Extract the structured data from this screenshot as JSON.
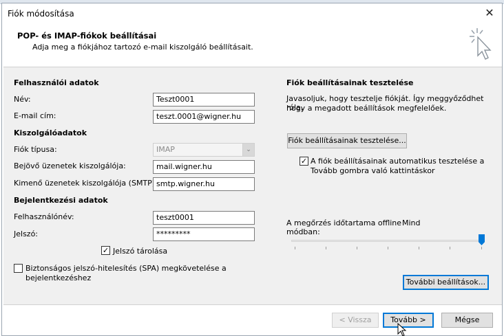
{
  "window": {
    "title": "Fiók módosítása"
  },
  "header": {
    "title": "POP- és IMAP-fiókok beállításai",
    "subtitle": "Adja meg a fiókjához tartozó e-mail kiszolgáló beállításait."
  },
  "user_section": {
    "title": "Felhasználói adatok",
    "name_label": "Név:",
    "name_value": "Teszt0001",
    "email_label": "E-mail cím:",
    "email_value": "teszt.0001@wigner.hu"
  },
  "server_section": {
    "title": "Kiszolgálóadatok",
    "account_type_label": "Fiók típusa:",
    "account_type_value": "IMAP",
    "incoming_label": "Bejövő üzenetek kiszolgálója:",
    "incoming_value": "mail.wigner.hu",
    "outgoing_label": "Kimenő üzenetek kiszolgálója (SMTP):",
    "outgoing_value": "smtp.wigner.hu"
  },
  "login_section": {
    "title": "Bejelentkezési adatok",
    "username_label": "Felhasználónév:",
    "username_value": "teszt0001",
    "password_label": "Jelszó:",
    "password_value": "*********",
    "remember_label": "Jelszó tárolása",
    "remember_checked": true,
    "spa_label_line1": "Biztonságos jelszó-hitelesítés (SPA) megkövetelése a",
    "spa_label_line2": "bejelentkezéshez",
    "spa_checked": false
  },
  "test_section": {
    "title": "Fiók beállításainak tesztelése",
    "description_line1": "Javasoljuk, hogy tesztelje fiókját. Így meggyőződhet róla,",
    "description_line2": "hogy a megadott beállítások megfelelőek.",
    "test_button": "Fiók beállításainak tesztelése...",
    "auto_test_line1": "A fiók beállításainak automatikus tesztelése a",
    "auto_test_line2": "Tovább gombra való kattintáskor",
    "auto_test_checked": true
  },
  "offline": {
    "label_line1": "A megőrzés időtartama offline",
    "label_line2": "módban:",
    "value": "Mind",
    "slider_fraction": 1.0
  },
  "buttons": {
    "more_settings": "További beállítások...",
    "back": "< Vissza",
    "next": "Tovább >",
    "cancel": "Mégse"
  },
  "colors": {
    "accent": "#0078d7",
    "panel": "#f0f0f0"
  }
}
